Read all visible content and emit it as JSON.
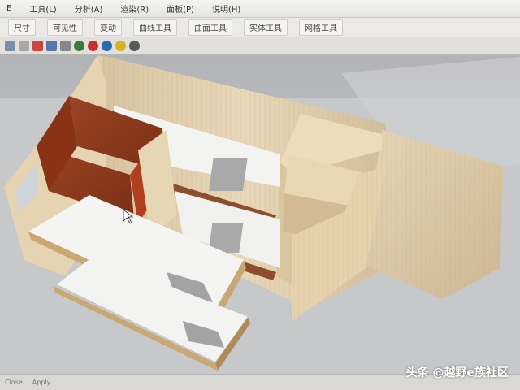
{
  "menu": {
    "items": [
      "E",
      "工具(L)",
      "分析(A)",
      "渲染(R)",
      "面板(P)",
      "说明(H)"
    ]
  },
  "tabs": [
    "尺寸",
    "可见性",
    "变动",
    "曲线工具",
    "曲面工具",
    "实体工具",
    "网格工具"
  ],
  "toolbar": {
    "icons": [
      "grid-icon",
      "select-icon",
      "snap-icon",
      "curve-icon",
      "surface-icon",
      "solid-icon",
      "render-icon",
      "material-icon",
      "light-icon",
      "help-icon"
    ]
  },
  "statusbar": {
    "items": [
      "Close",
      "Apply"
    ]
  },
  "watermark": {
    "text": "头条 @越野e族社区"
  },
  "colors": {
    "viewport": "#c2c4c6",
    "wood_light": "#e3d2b1",
    "wood_red": "#8e3a1f",
    "mattress": "#f2f2f0"
  }
}
